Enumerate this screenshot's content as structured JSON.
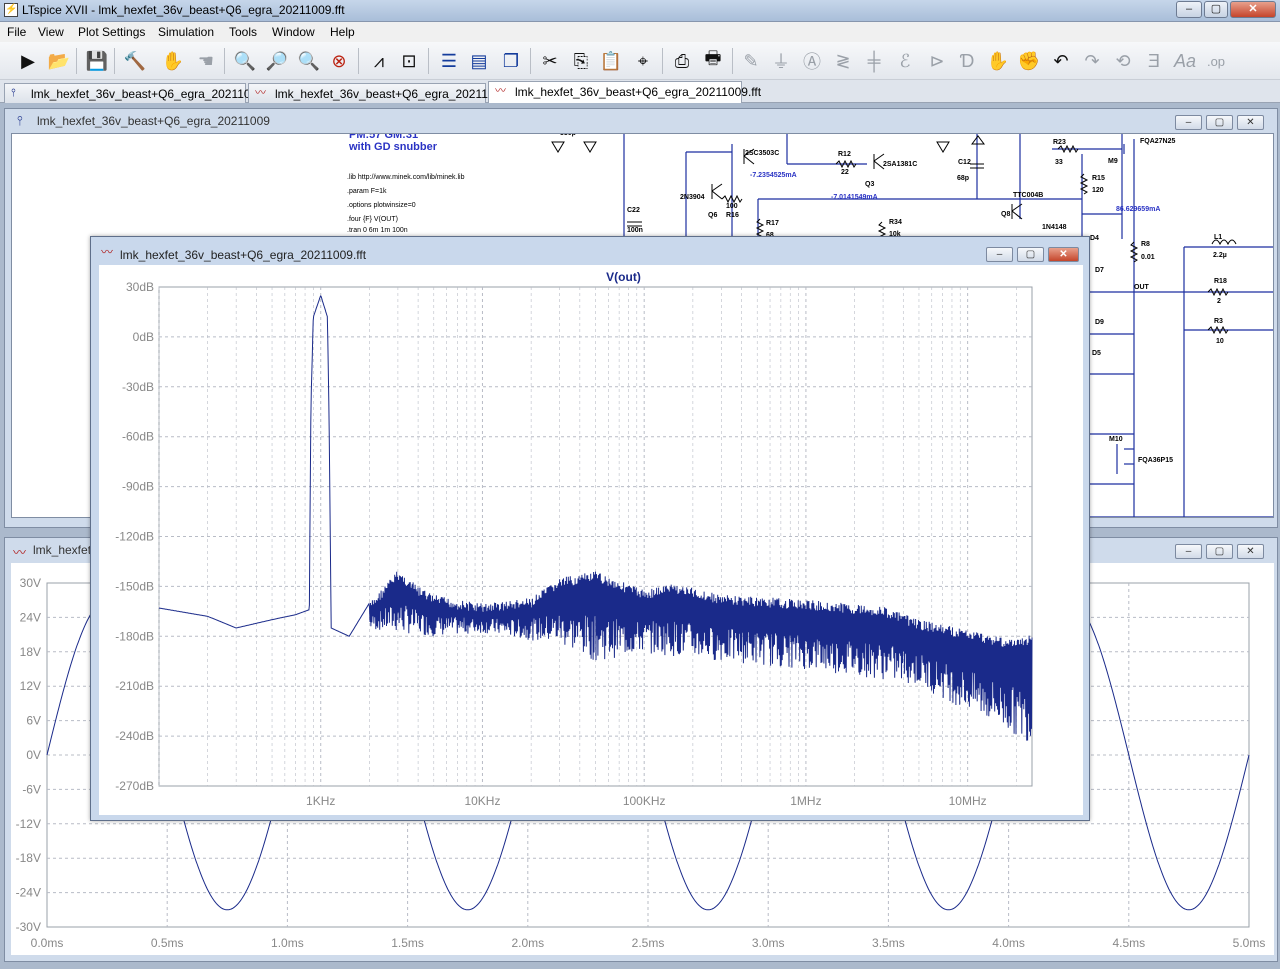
{
  "app": {
    "title": "LTspice XVII - lmk_hexfet_36v_beast+Q6_egra_20211009.fft",
    "window_buttons": [
      "–",
      "▢",
      "✕"
    ]
  },
  "menu": [
    "File",
    "View",
    "Plot Settings",
    "Simulation",
    "Tools",
    "Window",
    "Help"
  ],
  "toolbar": {
    "icons": [
      "run-icon",
      "open-icon",
      "save-icon",
      "control-panel-icon",
      "halt-icon",
      "pan-icon",
      "zoom-in-icon",
      "zoom-area-icon",
      "zoom-out-icon",
      "zoom-cancel-icon",
      "autorange-icon",
      "manual-limits-icon",
      "tile-horizontal-icon",
      "tile-vertical-icon",
      "cascade-icon",
      "cut-icon",
      "copy-icon",
      "paste-icon",
      "find-icon",
      "print-icon",
      "print-preview-icon",
      "wire-icon",
      "ground-icon",
      "label-net-icon",
      "resistor-icon",
      "capacitor-icon",
      "inductor-icon",
      "diode-icon",
      "component-icon",
      "move-icon",
      "drag-icon",
      "undo-icon",
      "redo-icon",
      "rotate-icon",
      "mirror-icon",
      "text-icon",
      "spice-directive-icon"
    ]
  },
  "tabs": [
    {
      "label": "lmk_hexfet_36v_beast+Q6_egra_20211009",
      "kind": "schematic"
    },
    {
      "label": "lmk_hexfet_36v_beast+Q6_egra_20211009",
      "kind": "waveform"
    },
    {
      "label": "lmk_hexfet_36v_beast+Q6_egra_20211009.fft",
      "kind": "fft"
    }
  ],
  "schematic_window": {
    "title": "lmk_hexfet_36v_beast+Q6_egra_20211009",
    "header_line1": "PM:57 GM:31",
    "header_line2": "with GD snubber",
    "directives": [
      ".lib http://www.minek.com/lib/minek.lib",
      ".param F=1k",
      ".options plotwinsize=0",
      ".four {F} V(OUT)",
      ".tran 0 6m 1m 100n"
    ],
    "labels": [
      "2SC3503C",
      "R12",
      "22",
      "2SA1381C",
      "Q3",
      "C12",
      "68p",
      "R23",
      "33",
      "M9",
      "FQA27N25",
      "R15",
      "120",
      "2N3904",
      "Q6",
      "100",
      "R16",
      "R17",
      "68",
      "C22",
      "100n",
      "R34",
      "10k",
      "TTC004B",
      "Q8",
      "1N4148",
      "D4",
      "R8",
      "0.01",
      "L1",
      "2.2µ",
      "R18",
      "2",
      "R3",
      "10",
      "D7",
      "OUT",
      "D9",
      "D5",
      "M10",
      "FQA36P15",
      "330p"
    ],
    "currents": [
      "-7.2354525mA",
      "-7.0141549mA",
      "86.629659mA"
    ]
  },
  "waveform_window": {
    "title": "lmk_hexfet_36v_beast+Q6_egra_20211009",
    "y_ticks": [
      "30V",
      "24V",
      "18V",
      "12V",
      "6V",
      "0V",
      "-6V",
      "-12V",
      "-18V",
      "-24V",
      "-30V"
    ],
    "x_ticks": [
      "0.0ms",
      "0.5ms",
      "1.0ms",
      "1.5ms",
      "2.0ms",
      "2.5ms",
      "3.0ms",
      "3.5ms",
      "4.0ms",
      "4.5ms",
      "5.0ms"
    ]
  },
  "fft_window": {
    "title": "lmk_hexfet_36v_beast+Q6_egra_20211009.fft",
    "trace_color": "#1a2a8a",
    "grid_color": "#b8bcc6"
  },
  "chart_data": [
    {
      "type": "line",
      "title": "V(out)",
      "x_scale": "log",
      "xlim": [
        100,
        25000000
      ],
      "ylim": [
        -270,
        30
      ],
      "y_ticks": [
        "30dB",
        "0dB",
        "-30dB",
        "-60dB",
        "-90dB",
        "-120dB",
        "-150dB",
        "-180dB",
        "-210dB",
        "-240dB",
        "-270dB"
      ],
      "x_ticks": [
        "1KHz",
        "10KHz",
        "100KHz",
        "1MHz",
        "10MHz"
      ],
      "grid": true,
      "series": [
        {
          "name": "V(out)",
          "upper_envelope": [
            [
              100,
              -163
            ],
            [
              200,
              -168
            ],
            [
              300,
              -175
            ],
            [
              500,
              -170
            ],
            [
              700,
              -167
            ],
            [
              850,
              -164
            ],
            [
              870,
              -40
            ],
            [
              900,
              12
            ],
            [
              1000,
              25
            ],
            [
              1100,
              12
            ],
            [
              1130,
              -60
            ],
            [
              1160,
              -175
            ],
            [
              1500,
              -180
            ],
            [
              2000,
              -160
            ],
            [
              3000,
              -140
            ],
            [
              4000,
              -150
            ],
            [
              5000,
              -155
            ],
            [
              7000,
              -158
            ],
            [
              10000,
              -160
            ],
            [
              20000,
              -157
            ],
            [
              30000,
              -145
            ],
            [
              50000,
              -141
            ],
            [
              100000,
              -152
            ],
            [
              150000,
              -148
            ],
            [
              300000,
              -155
            ],
            [
              1000000,
              -158
            ],
            [
              3000000,
              -162
            ],
            [
              5000000,
              -170
            ],
            [
              10000000,
              -176
            ],
            [
              20000000,
              -182
            ],
            [
              25000000,
              -178
            ]
          ],
          "lower_envelope": [
            [
              2000,
              -176
            ],
            [
              3000,
              -178
            ],
            [
              5000,
              -180
            ],
            [
              10000,
              -178
            ],
            [
              30000,
              -185
            ],
            [
              50000,
              -195
            ],
            [
              100000,
              -190
            ],
            [
              300000,
              -195
            ],
            [
              1000000,
              -200
            ],
            [
              3000000,
              -206
            ],
            [
              5000000,
              -210
            ],
            [
              10000000,
              -225
            ],
            [
              20000000,
              -240
            ],
            [
              25000000,
              -245
            ]
          ]
        }
      ]
    },
    {
      "type": "line",
      "title": "",
      "xlabel": "",
      "ylabel": "",
      "xlim": [
        0,
        5
      ],
      "ylim": [
        -30,
        30
      ],
      "series": [
        {
          "name": "",
          "waveform": "sine",
          "frequency_khz": 1,
          "amplitude_v": 27,
          "phase_shift_ms": 0
        }
      ]
    }
  ]
}
